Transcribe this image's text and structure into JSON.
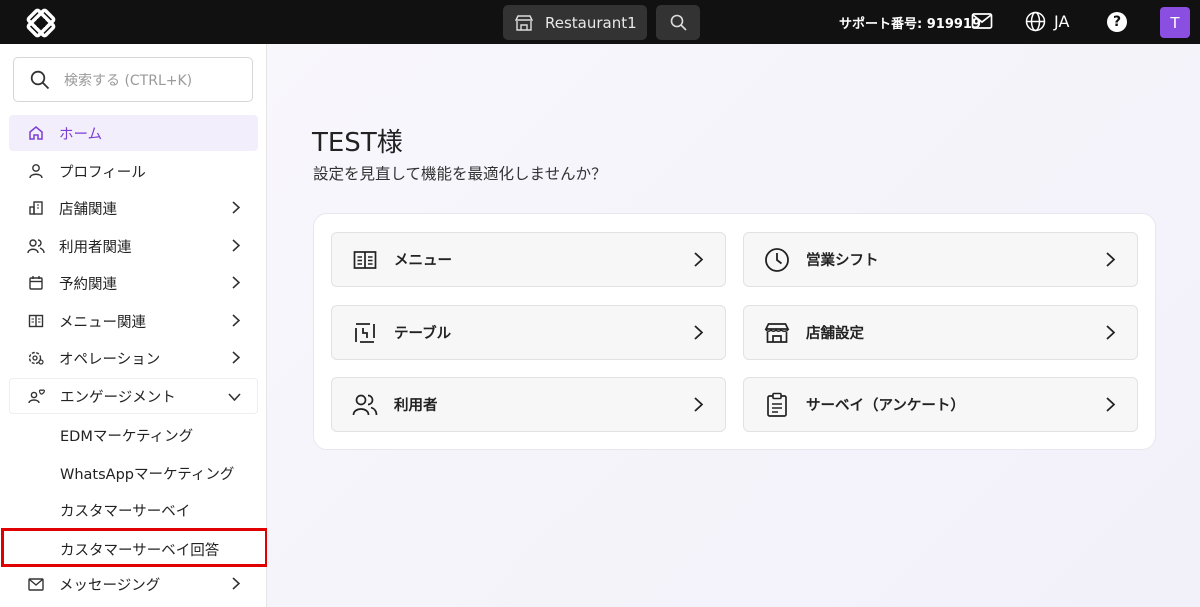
{
  "topbar": {
    "store_name": "Restaurant1",
    "support_label": "サポート番号: 919919",
    "language": "JA",
    "help": "?",
    "avatar_initial": "T"
  },
  "sidebar": {
    "search_placeholder": "検索する (CTRL+K)",
    "items": [
      {
        "label": "ホーム",
        "icon": "home-icon"
      },
      {
        "label": "プロフィール",
        "icon": "user-icon"
      },
      {
        "label": "店舗関連",
        "icon": "building-icon"
      },
      {
        "label": "利用者関連",
        "icon": "users-icon"
      },
      {
        "label": "予約関連",
        "icon": "calendar-icon"
      },
      {
        "label": "メニュー関連",
        "icon": "menu-book-icon"
      },
      {
        "label": "オペレーション",
        "icon": "gear-user-icon"
      },
      {
        "label": "エンゲージメント",
        "icon": "engagement-icon"
      },
      {
        "label": "メッセージング",
        "icon": "mail-icon"
      }
    ],
    "sub_items": [
      "EDMマーケティング",
      "WhatsAppマーケティング",
      "カスタマーサーベイ",
      "カスタマーサーベイ回答"
    ]
  },
  "main": {
    "greeting": "TEST様",
    "subtitle": "設定を見直して機能を最適化しませんか？",
    "tiles": [
      {
        "label": "メニュー",
        "icon": "menu-book-icon"
      },
      {
        "label": "営業シフト",
        "icon": "clock-icon"
      },
      {
        "label": "テーブル",
        "icon": "table-icon"
      },
      {
        "label": "店舗設定",
        "icon": "store-icon"
      },
      {
        "label": "利用者",
        "icon": "users-icon"
      },
      {
        "label": "サーベイ（アンケート）",
        "icon": "clipboard-icon"
      }
    ]
  },
  "colors": {
    "accent": "#8a4fe0",
    "topbar": "#111111",
    "highlight": "#e00000"
  }
}
